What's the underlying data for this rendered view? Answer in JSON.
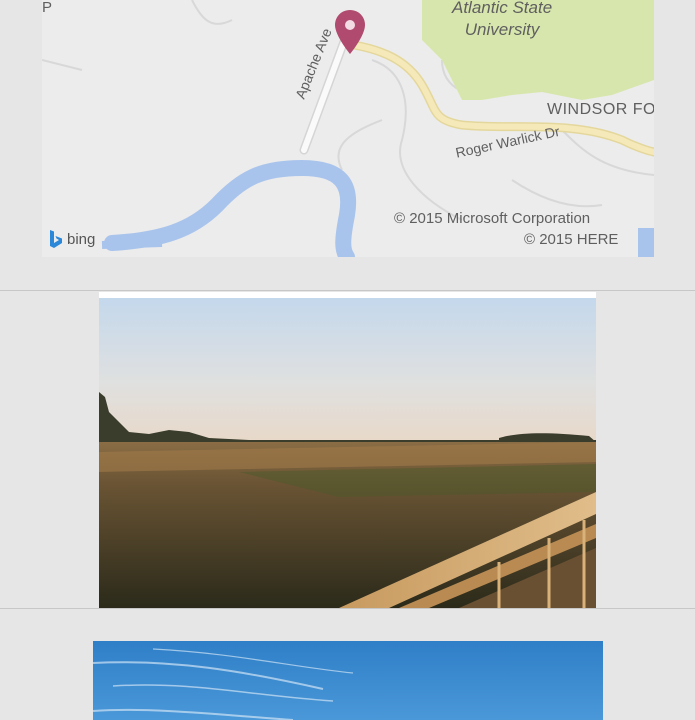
{
  "map": {
    "poi_label_line1": "Atlantic State",
    "poi_label_line2": "University",
    "area_label": "WINDSOR FO",
    "street_1": "Apache Ave",
    "street_2": "Roger Warlick Dr",
    "corner_glyph": "P",
    "copyright_microsoft": "© 2015 Microsoft Corporation",
    "copyright_here": "© 2015 HERE",
    "provider": "bing"
  },
  "colors": {
    "page_bg": "#e6e6e6",
    "map_land": "#ececec",
    "map_park": "#d7e6ad",
    "map_water": "#a9c4ec",
    "map_road": "#f6e9b9",
    "pin": "#b04a6e",
    "bing_logo": "#2b88d8"
  },
  "photos": [
    {
      "subject": "marsh-boardwalk-sunset"
    },
    {
      "subject": "blue-sky"
    }
  ]
}
